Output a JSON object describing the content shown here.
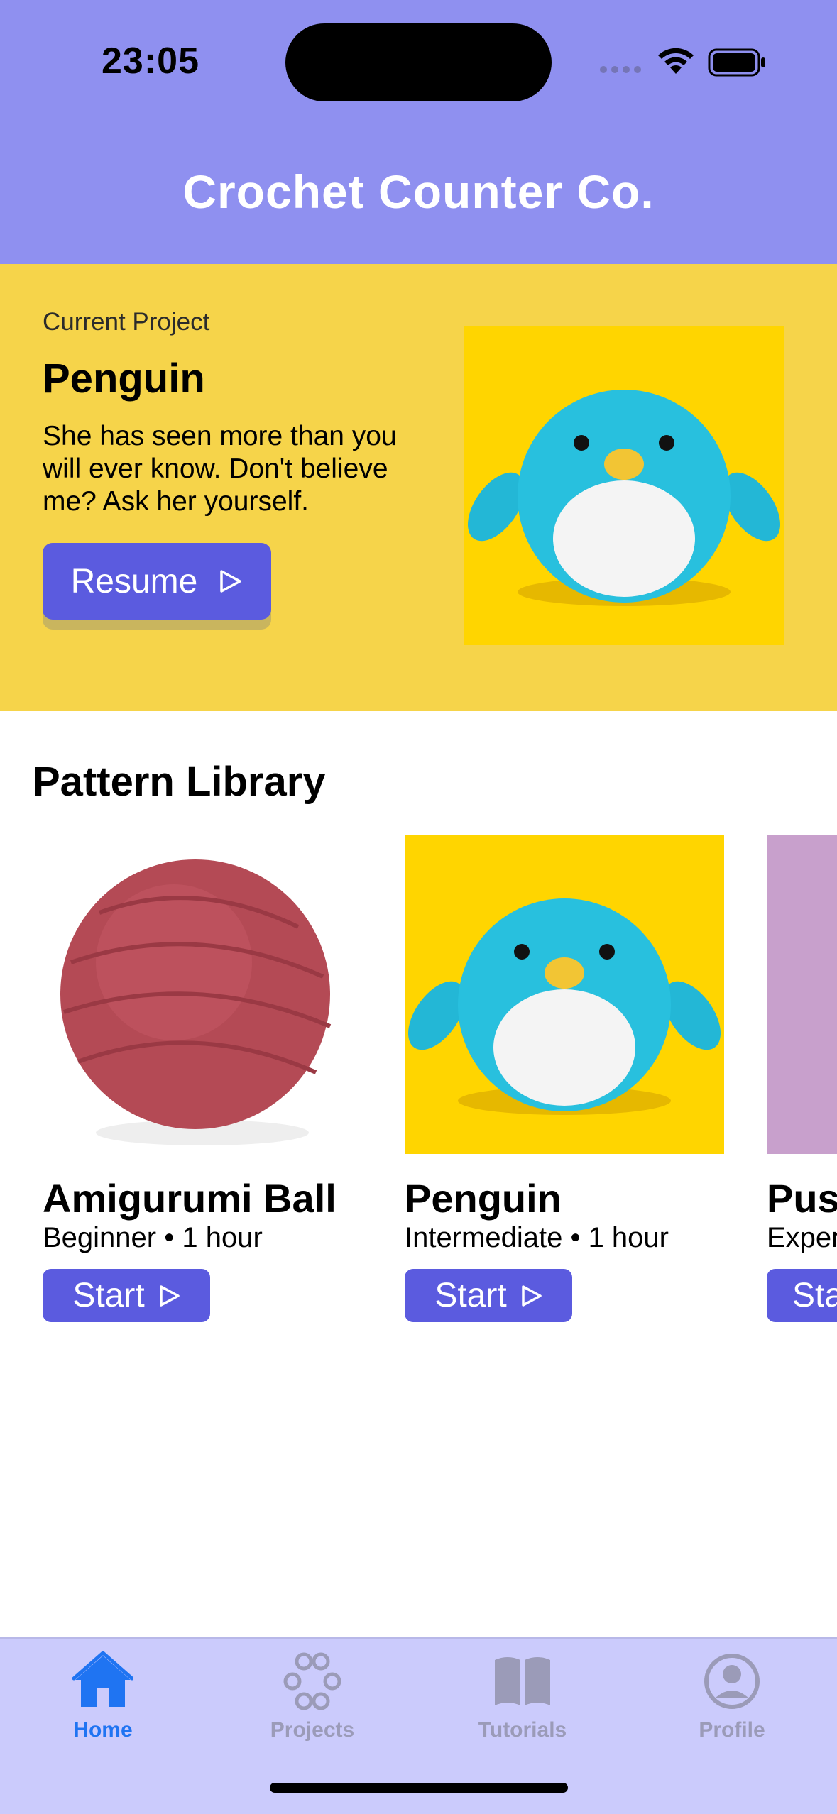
{
  "status_bar": {
    "time": "23:05"
  },
  "header": {
    "title": "Crochet Counter Co."
  },
  "current_project": {
    "label": "Current Project",
    "title": "Penguin",
    "description": "She has seen more than you will ever know. Don't believe me? Ask her yourself.",
    "resume_label": "Resume",
    "resume_icon": "play-outline-icon",
    "image_icon": "penguin-amigurumi-image"
  },
  "pattern_library": {
    "title": "Pattern Library",
    "items": [
      {
        "title": "Amigurumi Ball",
        "meta": "Beginner • 1 hour",
        "start_label": "Start"
      },
      {
        "title": "Penguin",
        "meta": "Intermediate • 1 hour",
        "start_label": "Start"
      },
      {
        "title": "Pus",
        "meta": "Exper",
        "start_label": "Sta"
      }
    ]
  },
  "tabbar": {
    "items": [
      {
        "label": "Home",
        "icon": "house-icon",
        "active": true
      },
      {
        "label": "Projects",
        "icon": "circles-icon",
        "active": false
      },
      {
        "label": "Tutorials",
        "icon": "book-icon",
        "active": false
      },
      {
        "label": "Profile",
        "icon": "person-circle-icon",
        "active": false
      }
    ]
  },
  "colors": {
    "header_bg": "#8f90f0",
    "banner_bg": "#f6d44a",
    "button_bg": "#5b5bdf",
    "tabbar_bg": "#cbcbfc",
    "active_tab": "#1f74f2",
    "inactive_tab": "#9b9bb8"
  }
}
